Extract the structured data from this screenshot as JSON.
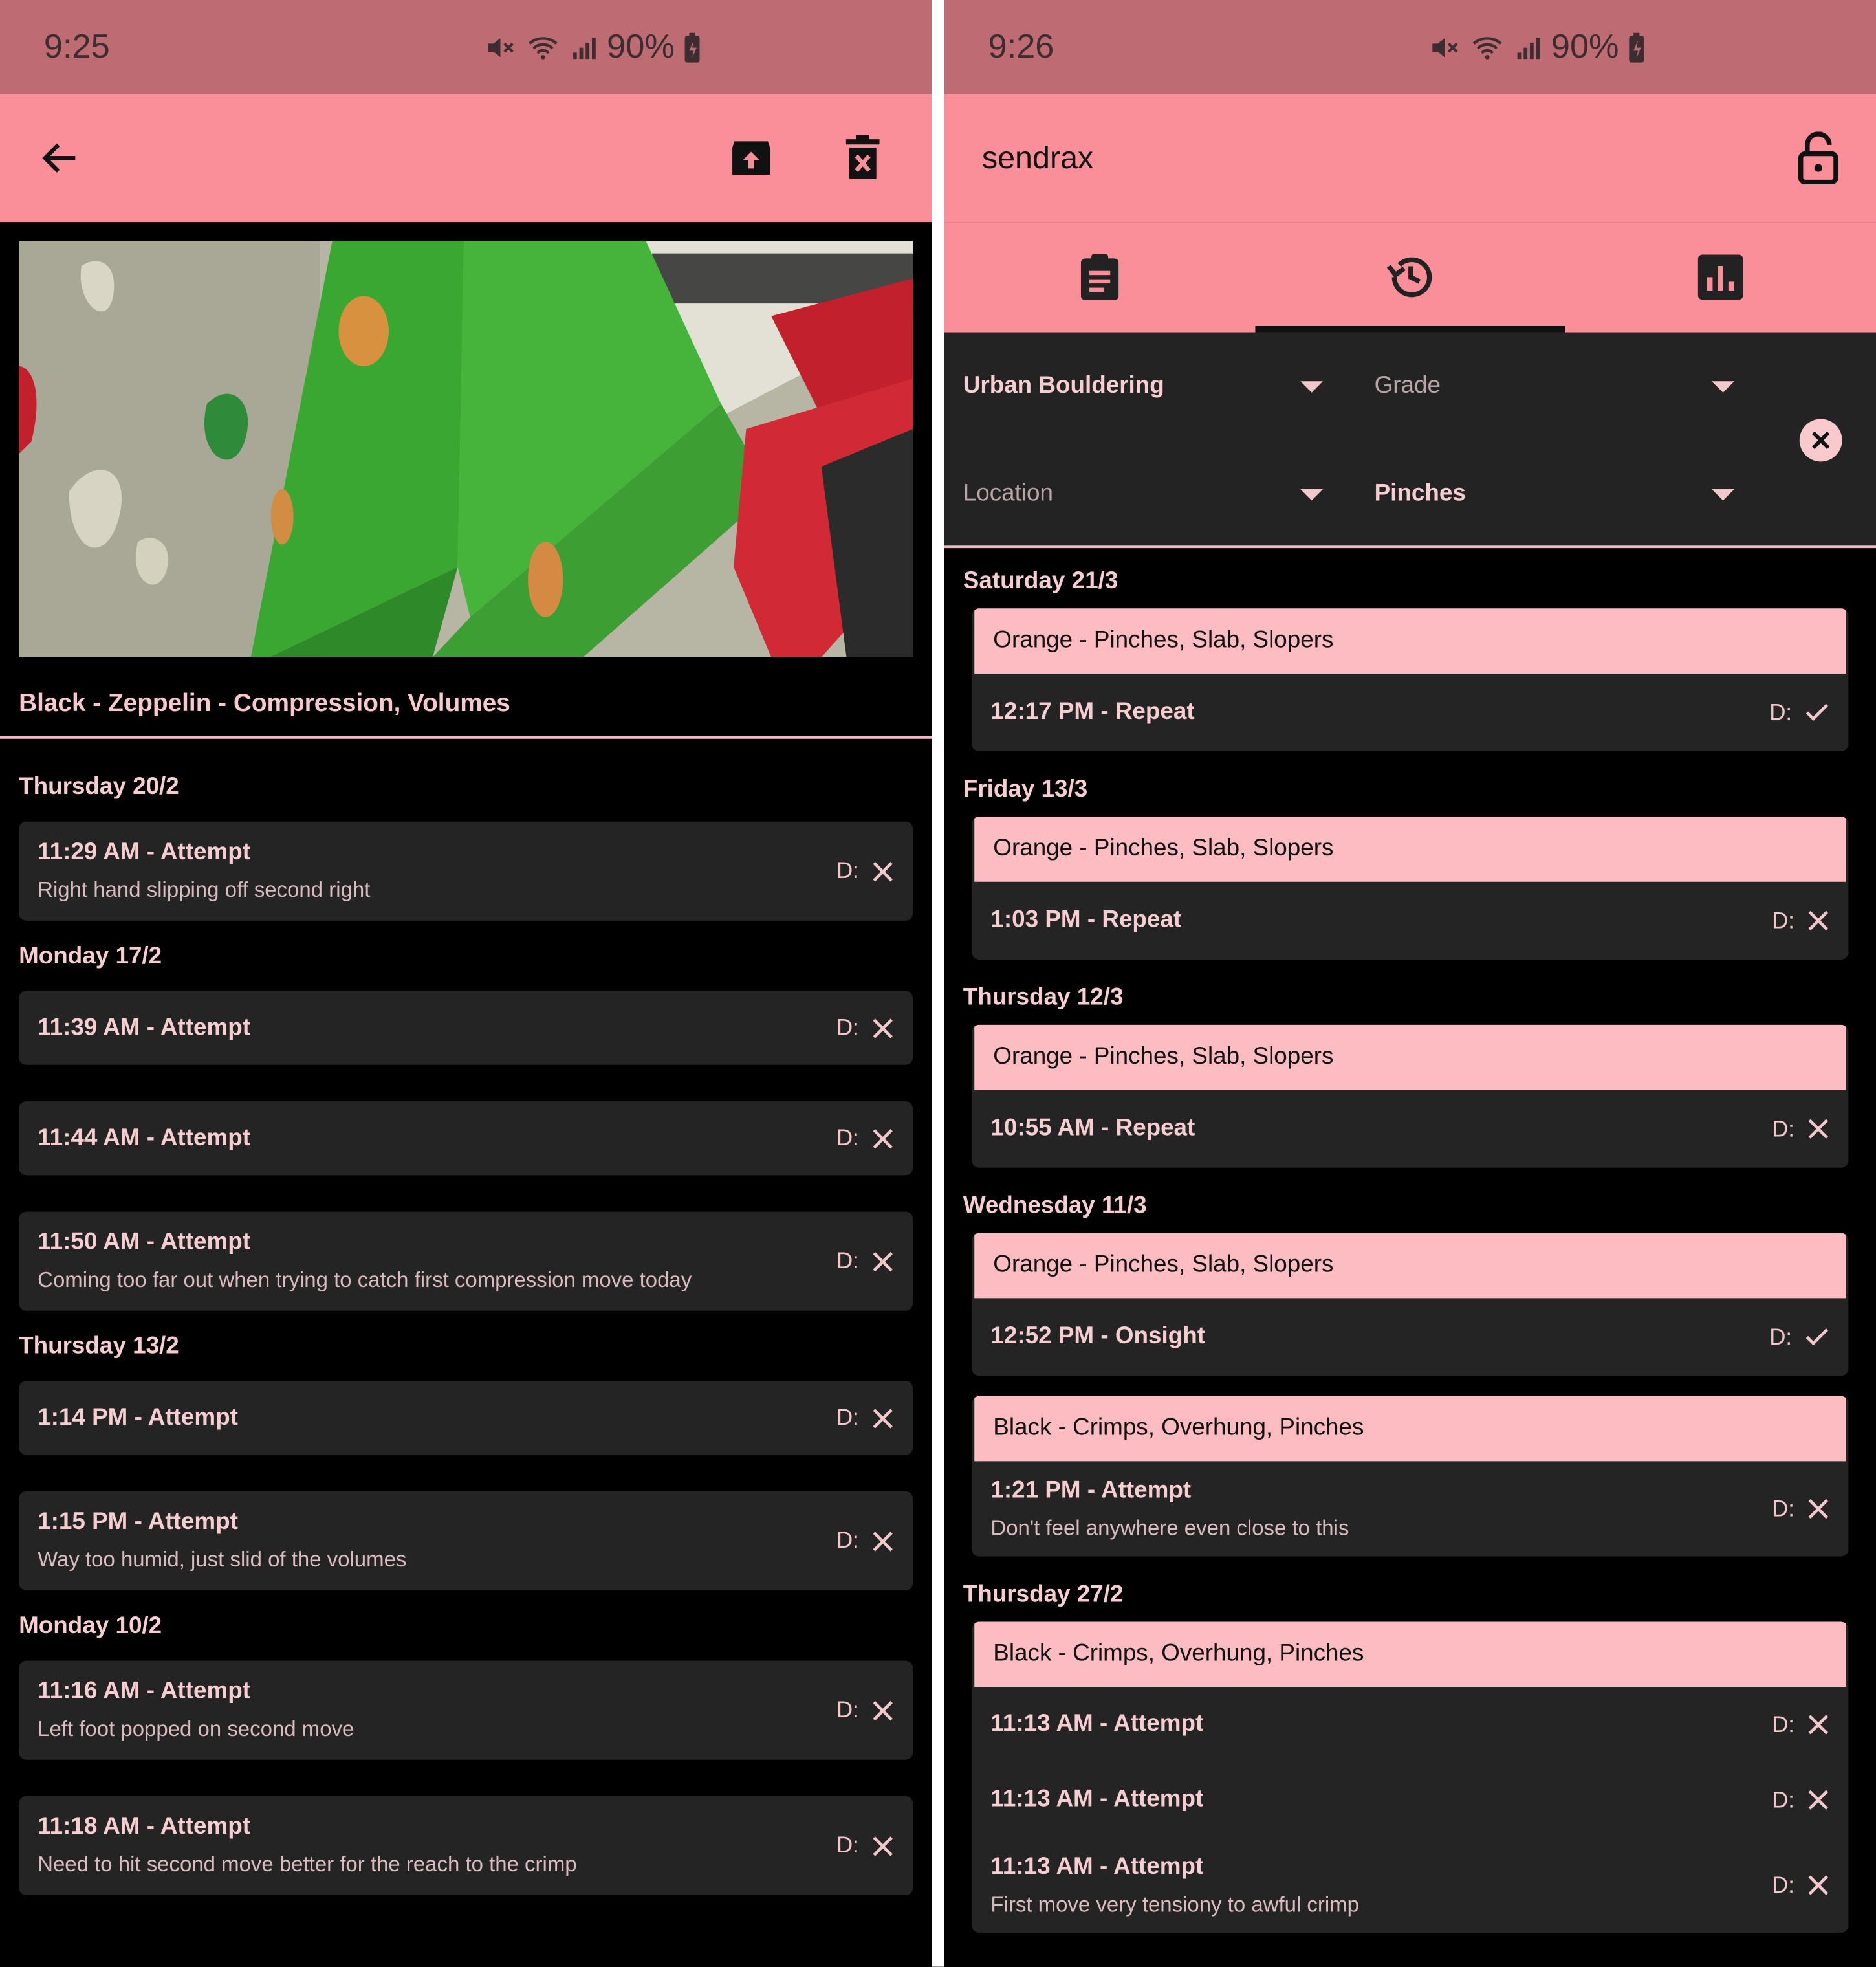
{
  "left": {
    "status": {
      "time": "9:25",
      "battery": "90%"
    },
    "route_title": "Black - Zeppelin - Compression, Volumes",
    "groups": [
      {
        "date": "Thursday 20/2",
        "entries": [
          {
            "time": "11:29 AM - Attempt",
            "note": "Right hand slipping off second right",
            "d_label": "D:",
            "result": "fail"
          }
        ]
      },
      {
        "date": "Monday 17/2",
        "entries": [
          {
            "time": "11:39 AM - Attempt",
            "note": "",
            "d_label": "D:",
            "result": "fail"
          },
          {
            "time": "11:44 AM - Attempt",
            "note": "",
            "d_label": "D:",
            "result": "fail"
          },
          {
            "time": "11:50 AM - Attempt",
            "note": "Coming too far out when trying to catch first compression move today",
            "d_label": "D:",
            "result": "fail"
          }
        ]
      },
      {
        "date": "Thursday 13/2",
        "entries": [
          {
            "time": "1:14 PM - Attempt",
            "note": "",
            "d_label": "D:",
            "result": "fail"
          },
          {
            "time": "1:15 PM - Attempt",
            "note": "Way too humid, just slid of the volumes",
            "d_label": "D:",
            "result": "fail"
          }
        ]
      },
      {
        "date": "Monday 10/2",
        "entries": [
          {
            "time": "11:16 AM - Attempt",
            "note": "Left foot popped on second move",
            "d_label": "D:",
            "result": "fail"
          },
          {
            "time": "11:18 AM - Attempt",
            "note": "Need to hit second move better for the reach to the crimp",
            "d_label": "D:",
            "result": "fail"
          }
        ]
      }
    ]
  },
  "right": {
    "status": {
      "time": "9:26",
      "battery": "90%"
    },
    "app_title": "sendrax",
    "filters": {
      "gym": "Urban Bouldering",
      "grade": "Grade",
      "location": "Location",
      "hold": "Pinches"
    },
    "groups": [
      {
        "date": "Saturday 21/3",
        "cards": [
          {
            "route": "Orange - Pinches, Slab, Slopers",
            "entries": [
              {
                "time": "12:17 PM - Repeat",
                "note": "",
                "d_label": "D:",
                "result": "success"
              }
            ]
          }
        ]
      },
      {
        "date": "Friday 13/3",
        "cards": [
          {
            "route": "Orange - Pinches, Slab, Slopers",
            "entries": [
              {
                "time": "1:03 PM - Repeat",
                "note": "",
                "d_label": "D:",
                "result": "fail"
              }
            ]
          }
        ]
      },
      {
        "date": "Thursday 12/3",
        "cards": [
          {
            "route": "Orange - Pinches, Slab, Slopers",
            "entries": [
              {
                "time": "10:55 AM - Repeat",
                "note": "",
                "d_label": "D:",
                "result": "fail"
              }
            ]
          }
        ]
      },
      {
        "date": "Wednesday 11/3",
        "cards": [
          {
            "route": "Orange - Pinches, Slab, Slopers",
            "entries": [
              {
                "time": "12:52 PM - Onsight",
                "note": "",
                "d_label": "D:",
                "result": "success"
              }
            ]
          },
          {
            "route": "Black - Crimps, Overhung, Pinches",
            "entries": [
              {
                "time": "1:21 PM - Attempt",
                "note": "Don't feel anywhere even close to this",
                "d_label": "D:",
                "result": "fail"
              }
            ]
          }
        ]
      },
      {
        "date": "Thursday 27/2",
        "cards": [
          {
            "route": "Black - Crimps, Overhung, Pinches",
            "entries": [
              {
                "time": "11:13 AM - Attempt",
                "note": "",
                "d_label": "D:",
                "result": "fail"
              },
              {
                "time": "11:13 AM - Attempt",
                "note": "",
                "d_label": "D:",
                "result": "fail"
              },
              {
                "time": "11:13 AM - Attempt",
                "note": "First move very tensiony to awful crimp",
                "d_label": "D:",
                "result": "fail"
              }
            ]
          }
        ]
      }
    ]
  },
  "colors": {
    "accent": "#fb8f99",
    "status_bar": "#bd6c74",
    "card_header": "#fdbcc1",
    "card_bg": "#242424",
    "text": "#f6cdd1"
  }
}
